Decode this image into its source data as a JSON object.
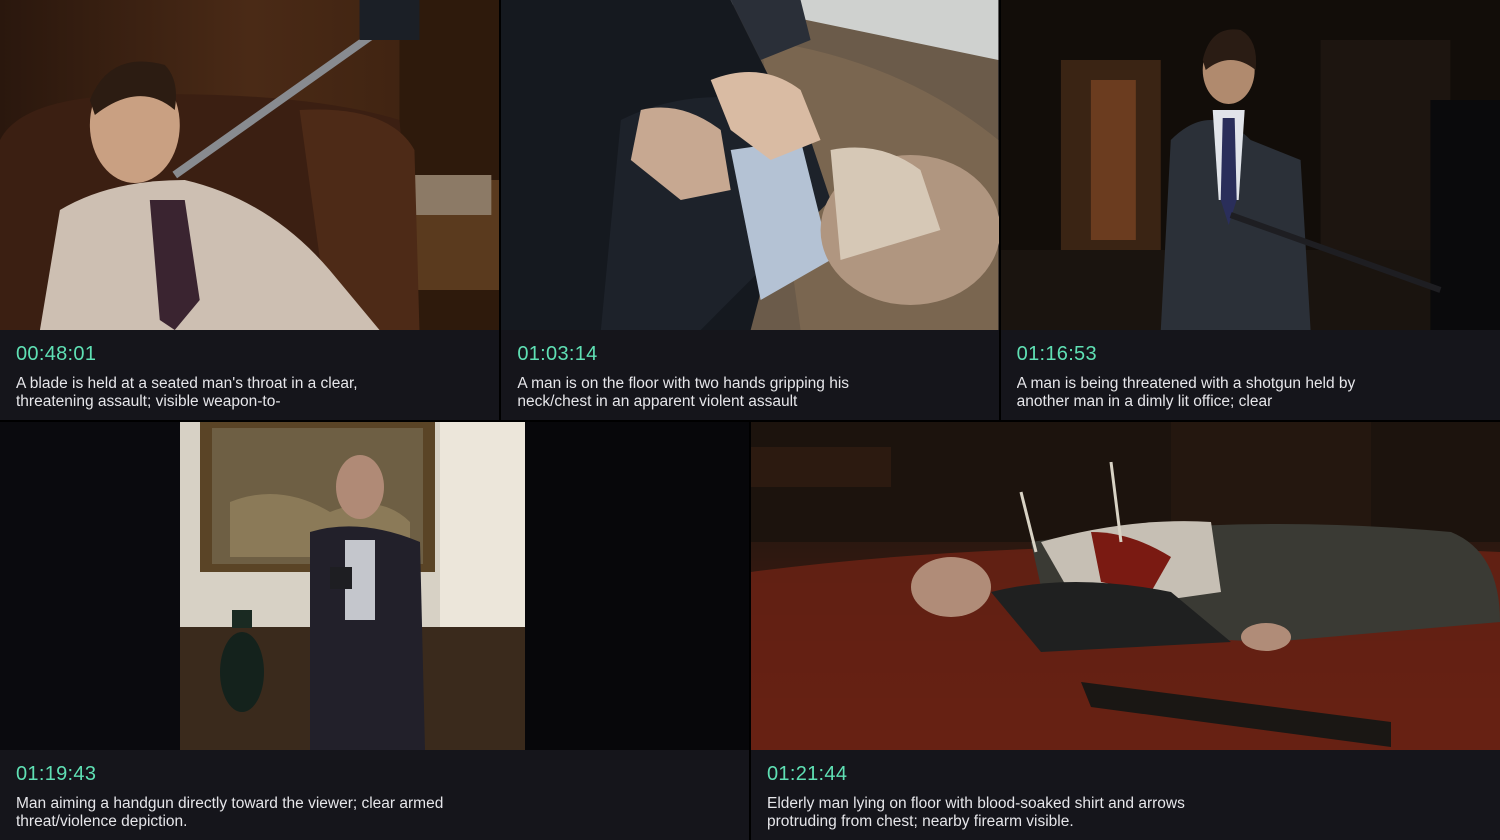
{
  "scenes": [
    {
      "timecode": "00:48:01",
      "description": "A blade is held at a seated man's throat in a clear, threatening assault; visible weapon-to-"
    },
    {
      "timecode": "01:03:14",
      "description": "A man is on the floor with two hands gripping his neck/chest in an apparent violent assault"
    },
    {
      "timecode": "01:16:53",
      "description": "A man is being threatened with a shotgun held by another man in a dimly lit office; clear"
    },
    {
      "timecode": "01:19:43",
      "description": "Man aiming a handgun directly toward the viewer; clear armed threat/violence depiction."
    },
    {
      "timecode": "01:21:44",
      "description": "Elderly man lying on floor with blood-soaked shirt and arrows protruding from chest; nearby firearm visible."
    }
  ],
  "colors": {
    "timecode": "#5fe0b4",
    "caption_text": "#e6e6ea",
    "caption_bg": "#15151b"
  }
}
